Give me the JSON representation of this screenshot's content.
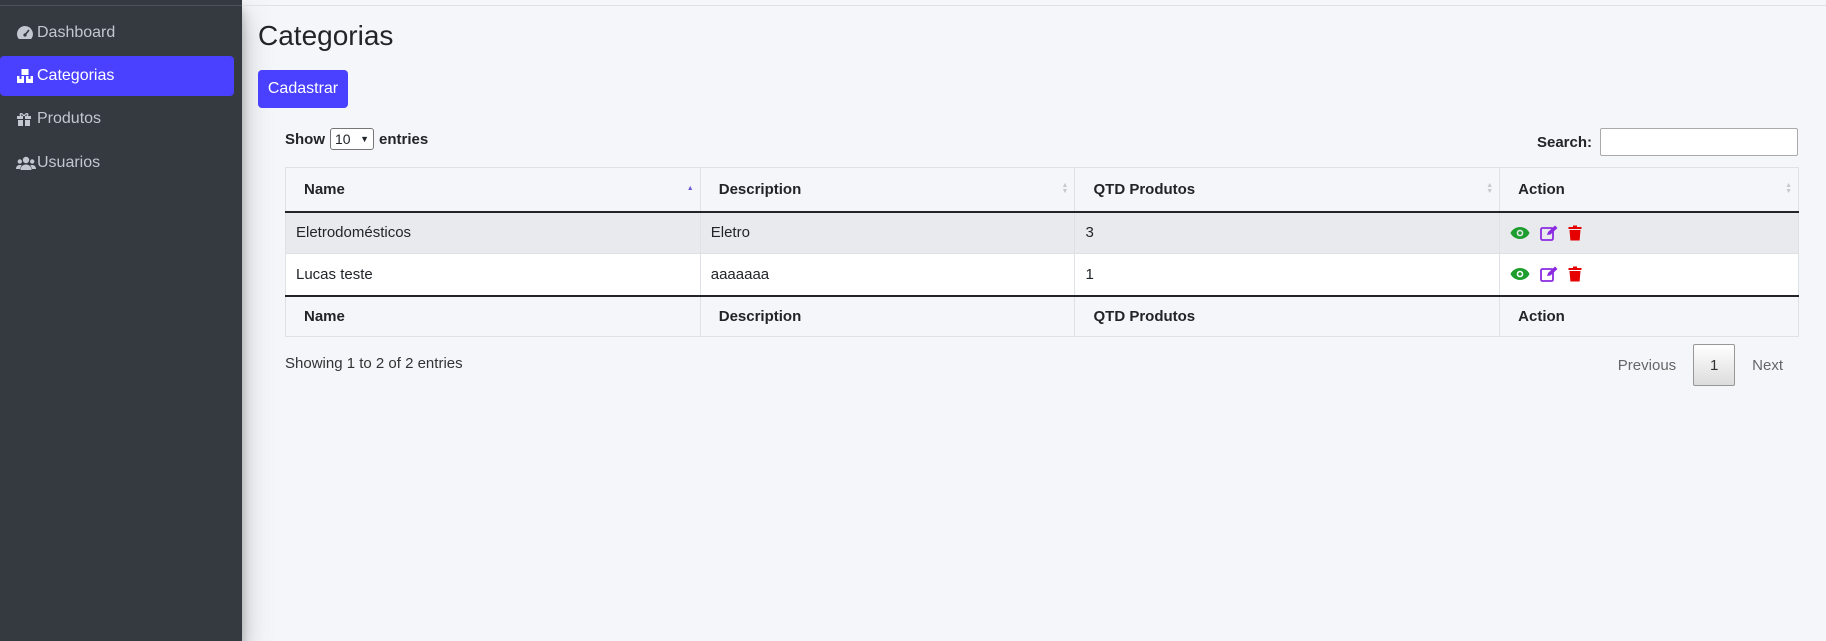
{
  "sidebar": {
    "items": [
      {
        "label": "Dashboard",
        "icon": "tachometer-icon",
        "active": false
      },
      {
        "label": "Categorias",
        "icon": "boxes-icon",
        "active": true
      },
      {
        "label": "Produtos",
        "icon": "gift-icon",
        "active": false
      },
      {
        "label": "Usuarios",
        "icon": "users-icon",
        "active": false
      }
    ]
  },
  "page": {
    "title": "Categorias",
    "add_button": "Cadastrar"
  },
  "table_controls": {
    "show_label": "Show",
    "page_length": "10",
    "entries_label": "entries",
    "search_label": "Search:",
    "search_value": ""
  },
  "table": {
    "columns": [
      "Name",
      "Description",
      "QTD Produtos",
      "Action"
    ],
    "rows": [
      {
        "name": "Eletrodomésticos",
        "description": "Eletro",
        "qtd": "3"
      },
      {
        "name": "Lucas teste",
        "description": "aaaaaaa",
        "qtd": "1"
      }
    ],
    "action_icons": [
      "eye-icon",
      "edit-icon",
      "trash-icon"
    ]
  },
  "footer": {
    "info": "Showing 1 to 2 of 2 entries",
    "previous": "Previous",
    "current_page": "1",
    "next": "Next"
  },
  "colors": {
    "accent": "#4a40ff",
    "sidebar_bg": "#343a40",
    "view_icon": "#1e9e2e",
    "edit_icon": "#8a2be2",
    "delete_icon": "#e60000"
  }
}
